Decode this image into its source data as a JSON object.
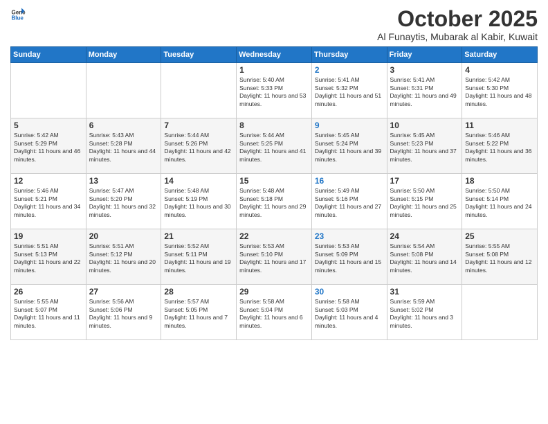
{
  "header": {
    "logo_general": "General",
    "logo_blue": "Blue",
    "month_title": "October 2025",
    "location": "Al Funaytis, Mubarak al Kabir, Kuwait"
  },
  "weekdays": [
    "Sunday",
    "Monday",
    "Tuesday",
    "Wednesday",
    "Thursday",
    "Friday",
    "Saturday"
  ],
  "weeks": [
    [
      {
        "day": "",
        "info": ""
      },
      {
        "day": "",
        "info": ""
      },
      {
        "day": "",
        "info": ""
      },
      {
        "day": "1",
        "info": "Sunrise: 5:40 AM\nSunset: 5:33 PM\nDaylight: 11 hours and 53 minutes."
      },
      {
        "day": "2",
        "info": "Sunrise: 5:41 AM\nSunset: 5:32 PM\nDaylight: 11 hours and 51 minutes.",
        "thursday": true
      },
      {
        "day": "3",
        "info": "Sunrise: 5:41 AM\nSunset: 5:31 PM\nDaylight: 11 hours and 49 minutes."
      },
      {
        "day": "4",
        "info": "Sunrise: 5:42 AM\nSunset: 5:30 PM\nDaylight: 11 hours and 48 minutes."
      }
    ],
    [
      {
        "day": "5",
        "info": "Sunrise: 5:42 AM\nSunset: 5:29 PM\nDaylight: 11 hours and 46 minutes."
      },
      {
        "day": "6",
        "info": "Sunrise: 5:43 AM\nSunset: 5:28 PM\nDaylight: 11 hours and 44 minutes."
      },
      {
        "day": "7",
        "info": "Sunrise: 5:44 AM\nSunset: 5:26 PM\nDaylight: 11 hours and 42 minutes."
      },
      {
        "day": "8",
        "info": "Sunrise: 5:44 AM\nSunset: 5:25 PM\nDaylight: 11 hours and 41 minutes."
      },
      {
        "day": "9",
        "info": "Sunrise: 5:45 AM\nSunset: 5:24 PM\nDaylight: 11 hours and 39 minutes.",
        "thursday": true
      },
      {
        "day": "10",
        "info": "Sunrise: 5:45 AM\nSunset: 5:23 PM\nDaylight: 11 hours and 37 minutes."
      },
      {
        "day": "11",
        "info": "Sunrise: 5:46 AM\nSunset: 5:22 PM\nDaylight: 11 hours and 36 minutes."
      }
    ],
    [
      {
        "day": "12",
        "info": "Sunrise: 5:46 AM\nSunset: 5:21 PM\nDaylight: 11 hours and 34 minutes."
      },
      {
        "day": "13",
        "info": "Sunrise: 5:47 AM\nSunset: 5:20 PM\nDaylight: 11 hours and 32 minutes."
      },
      {
        "day": "14",
        "info": "Sunrise: 5:48 AM\nSunset: 5:19 PM\nDaylight: 11 hours and 30 minutes."
      },
      {
        "day": "15",
        "info": "Sunrise: 5:48 AM\nSunset: 5:18 PM\nDaylight: 11 hours and 29 minutes."
      },
      {
        "day": "16",
        "info": "Sunrise: 5:49 AM\nSunset: 5:16 PM\nDaylight: 11 hours and 27 minutes.",
        "thursday": true
      },
      {
        "day": "17",
        "info": "Sunrise: 5:50 AM\nSunset: 5:15 PM\nDaylight: 11 hours and 25 minutes."
      },
      {
        "day": "18",
        "info": "Sunrise: 5:50 AM\nSunset: 5:14 PM\nDaylight: 11 hours and 24 minutes."
      }
    ],
    [
      {
        "day": "19",
        "info": "Sunrise: 5:51 AM\nSunset: 5:13 PM\nDaylight: 11 hours and 22 minutes."
      },
      {
        "day": "20",
        "info": "Sunrise: 5:51 AM\nSunset: 5:12 PM\nDaylight: 11 hours and 20 minutes."
      },
      {
        "day": "21",
        "info": "Sunrise: 5:52 AM\nSunset: 5:11 PM\nDaylight: 11 hours and 19 minutes."
      },
      {
        "day": "22",
        "info": "Sunrise: 5:53 AM\nSunset: 5:10 PM\nDaylight: 11 hours and 17 minutes."
      },
      {
        "day": "23",
        "info": "Sunrise: 5:53 AM\nSunset: 5:09 PM\nDaylight: 11 hours and 15 minutes.",
        "thursday": true
      },
      {
        "day": "24",
        "info": "Sunrise: 5:54 AM\nSunset: 5:08 PM\nDaylight: 11 hours and 14 minutes."
      },
      {
        "day": "25",
        "info": "Sunrise: 5:55 AM\nSunset: 5:08 PM\nDaylight: 11 hours and 12 minutes."
      }
    ],
    [
      {
        "day": "26",
        "info": "Sunrise: 5:55 AM\nSunset: 5:07 PM\nDaylight: 11 hours and 11 minutes."
      },
      {
        "day": "27",
        "info": "Sunrise: 5:56 AM\nSunset: 5:06 PM\nDaylight: 11 hours and 9 minutes."
      },
      {
        "day": "28",
        "info": "Sunrise: 5:57 AM\nSunset: 5:05 PM\nDaylight: 11 hours and 7 minutes."
      },
      {
        "day": "29",
        "info": "Sunrise: 5:58 AM\nSunset: 5:04 PM\nDaylight: 11 hours and 6 minutes."
      },
      {
        "day": "30",
        "info": "Sunrise: 5:58 AM\nSunset: 5:03 PM\nDaylight: 11 hours and 4 minutes.",
        "thursday": true
      },
      {
        "day": "31",
        "info": "Sunrise: 5:59 AM\nSunset: 5:02 PM\nDaylight: 11 hours and 3 minutes."
      },
      {
        "day": "",
        "info": ""
      }
    ]
  ]
}
